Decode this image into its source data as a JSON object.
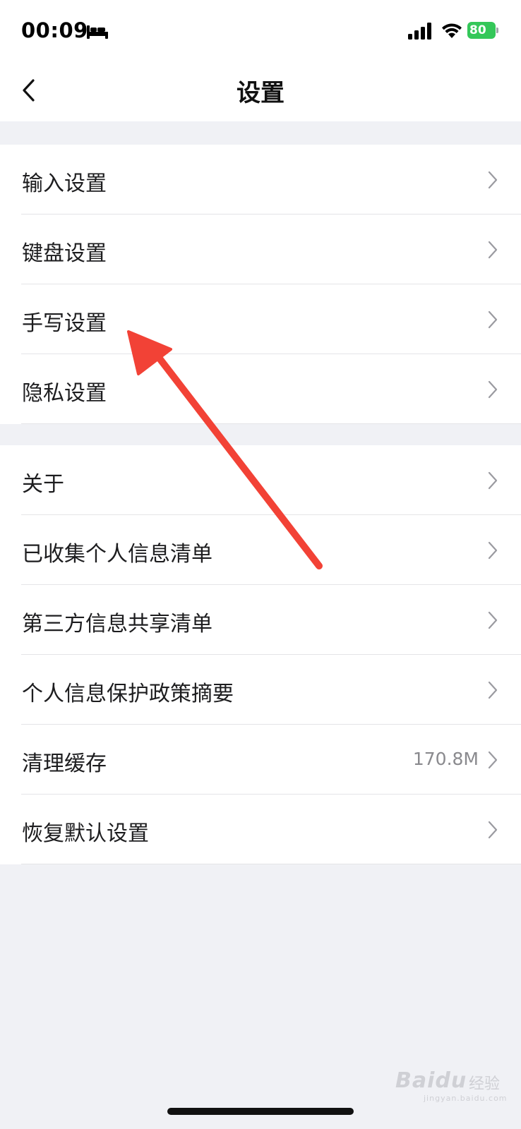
{
  "status_bar": {
    "time": "00:09",
    "battery_level": "80",
    "icons": [
      "bed-icon",
      "signal-icon",
      "wifi-icon",
      "battery-icon"
    ]
  },
  "nav": {
    "title": "设置",
    "back_icon": "chevron-left-icon"
  },
  "groups": [
    {
      "items": [
        {
          "label": "输入设置"
        },
        {
          "label": "键盘设置"
        },
        {
          "label": "手写设置"
        },
        {
          "label": "隐私设置"
        }
      ]
    },
    {
      "items": [
        {
          "label": "关于"
        },
        {
          "label": "已收集个人信息清单"
        },
        {
          "label": "第三方信息共享清单"
        },
        {
          "label": "个人信息保护政策摘要"
        },
        {
          "label": "清理缓存",
          "value": "170.8M"
        },
        {
          "label": "恢复默认设置"
        }
      ]
    }
  ],
  "watermark": {
    "brand": "Baidu",
    "cn": "经验",
    "url": "jingyan.baidu.com"
  },
  "colors": {
    "background": "#f0f1f5",
    "card": "#ffffff",
    "annotation_arrow": "#f24236",
    "battery": "#34c759"
  }
}
